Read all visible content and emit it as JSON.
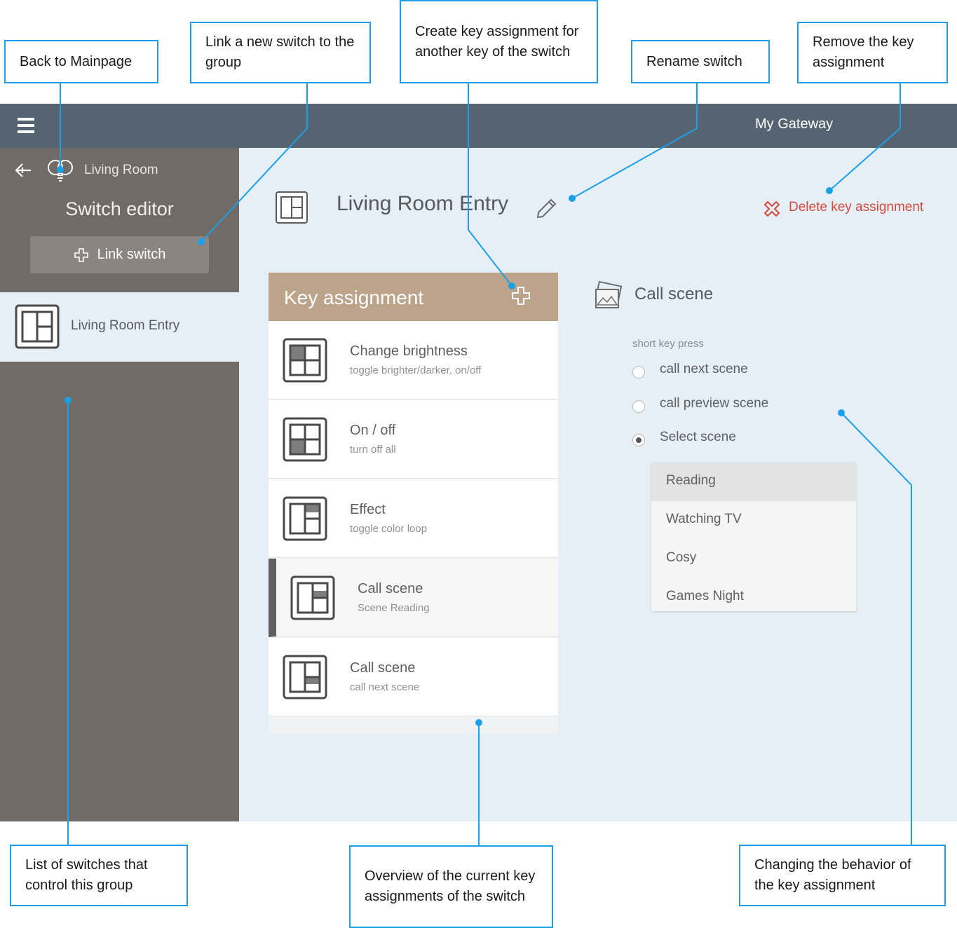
{
  "callouts": {
    "back_to_mainpage": "Back to Mainpage",
    "link_new_switch": "Link a new switch to the group",
    "create_key_assignment": "Create key assignment for another key of the switch",
    "rename_switch": "Rename switch",
    "remove_key_assignment": "Remove the key assignment",
    "list_of_switches": "List of switches that control this group",
    "overview_key_assignments": "Overview of the current key assignments of the switch",
    "changing_behavior": "Changing the behavior of the key assignment"
  },
  "header": {
    "gateway": "My Gateway"
  },
  "sidebar": {
    "room": "Living Room",
    "title": "Switch editor",
    "link_switch": "Link switch",
    "items": [
      {
        "label": "Living Room Entry"
      }
    ]
  },
  "main": {
    "switch_name": "Living Room Entry",
    "delete_label": "Delete key assignment"
  },
  "key_assignment": {
    "title": "Key assignment",
    "rows": [
      {
        "title": "Change brightness",
        "subtitle": "toggle brighter/darker, on/off"
      },
      {
        "title": "On / off",
        "subtitle": "turn off all"
      },
      {
        "title": "Effect",
        "subtitle": "toggle color loop"
      },
      {
        "title": "Call scene",
        "subtitle": "Scene Reading"
      },
      {
        "title": "Call scene",
        "subtitle": "call next scene"
      }
    ]
  },
  "detail": {
    "title": "Call scene",
    "press_label": "short key press",
    "options": [
      {
        "label": "call next scene",
        "selected": false
      },
      {
        "label": "call preview scene",
        "selected": false
      },
      {
        "label": "Select scene",
        "selected": true
      }
    ],
    "scenes": [
      "Reading",
      "Watching TV",
      "Cosy",
      "Games Night"
    ],
    "selected_scene": "Reading"
  },
  "colors": {
    "topbar": "#566471",
    "sidebar": "#716b67",
    "main_bg": "#e6eef6",
    "card_header": "#bca48b",
    "delete": "#d24a3e",
    "callout_border": "#1ba0e8"
  }
}
